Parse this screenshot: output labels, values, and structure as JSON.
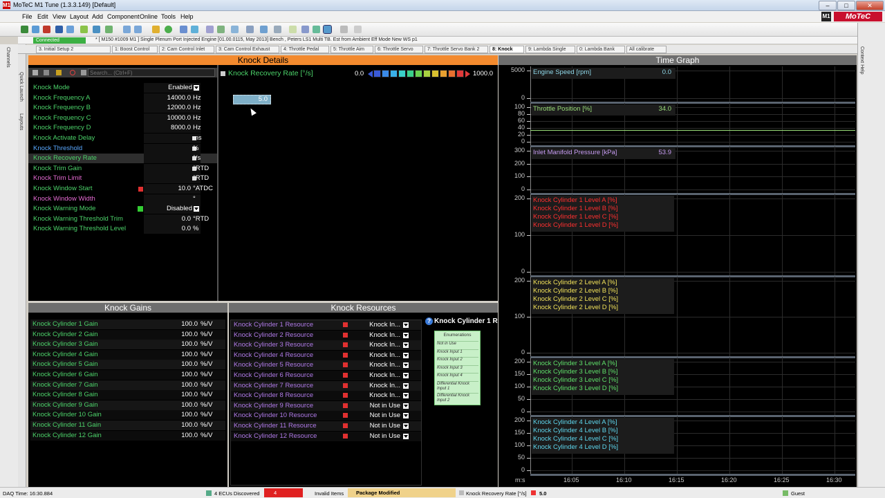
{
  "window": {
    "title": "MoTeC M1 Tune (1.3.3.149) [Default]",
    "min": "–",
    "max": "□",
    "close": "✕",
    "app_icon": "M1"
  },
  "menu": [
    "File",
    "Edit",
    "View",
    "Layout",
    "Add",
    "Component",
    "Online",
    "Tools",
    "Help"
  ],
  "brand": {
    "logo": "MoTeC",
    "m1": "M1"
  },
  "connection": {
    "status": "Connected",
    "desc": "* [ M150 #1009 M1 ]  Single Plenum Port Injected Engine [01.00.0115, May 2013] Bench , Peters LS1 Multi TB. Est from Ambient Eff Mode New WS p1"
  },
  "tabs": [
    "3. Initial Setup 2",
    "1: Boost Control",
    "2: Cam Control Inlet",
    "3: Cam Control Exhaust",
    "4: Throttle Pedal",
    "5: Throttle Aim",
    "6: Throttle Servo",
    "7: Throttle Servo Bank 2",
    "8: Knock",
    "9: Lambda Single",
    "0: Lambda Bank",
    "All calibrate"
  ],
  "side": {
    "channels": "Channels",
    "quick": "Quick Launch",
    "layouts": "Layouts",
    "help": "Context Help"
  },
  "knock_details": {
    "title": "Knock Details",
    "search_placeholder": "Search... (Ctrl+F)",
    "rows": [
      {
        "label": "Knock Mode",
        "value": "Enabled",
        "unit": "",
        "dd": true,
        "color": "#4cd36a"
      },
      {
        "label": "Knock Frequency A",
        "value": "14000.0",
        "unit": "Hz",
        "color": "#4cd36a"
      },
      {
        "label": "Knock Frequency B",
        "value": "12000.0",
        "unit": "Hz",
        "color": "#4cd36a"
      },
      {
        "label": "Knock Frequency C",
        "value": "10000.0",
        "unit": "Hz",
        "color": "#4cd36a"
      },
      {
        "label": "Knock Frequency D",
        "value": "8000.0",
        "unit": "Hz",
        "color": "#4cd36a"
      },
      {
        "label": "Knock Activate Delay",
        "value": "",
        "unit": "ms",
        "sq": true,
        "color": "#4cd36a"
      },
      {
        "label": "Knock Threshold",
        "value": "",
        "unit": "%",
        "sq": true,
        "color": "#5aa8ff"
      },
      {
        "label": "Knock Recovery Rate",
        "value": "",
        "unit": "°/s",
        "sq": true,
        "color": "#4cd36a",
        "selected": true
      },
      {
        "label": "Knock Trim Gain",
        "value": "",
        "unit": "°RTD",
        "sq": true,
        "color": "#4cd36a"
      },
      {
        "label": "Knock Trim Limit",
        "value": "",
        "unit": "°RTD",
        "sq": true,
        "color": "#e46ad2"
      },
      {
        "label": "Knock Window Start",
        "value": "10.0",
        "unit": "°ATDC",
        "flag": true,
        "color": "#4cd36a"
      },
      {
        "label": "Knock Window Width",
        "value": "",
        "unit": "°",
        "color": "#e46ad2"
      },
      {
        "label": "Knock Warning Mode",
        "value": "Disabled",
        "unit": "",
        "dd": true,
        "mark": true,
        "color": "#4cd36a"
      },
      {
        "label": "Knock Warning Threshold Trim",
        "value": "0.0",
        "unit": "°RTD",
        "color": "#4cd36a"
      },
      {
        "label": "Knock Warning Threshold Level",
        "value": "0.0",
        "unit": "%",
        "color": "#4cd36a"
      }
    ]
  },
  "recovery": {
    "title": "Knock Recovery Rate [°/s]",
    "min": "0.0",
    "max": "1000.0",
    "cell": "5.0"
  },
  "gains": {
    "title": "Knock Gains",
    "rows": [
      {
        "label": "Knock Cylinder 1 Gain",
        "value": "100.0",
        "unit": "%/V"
      },
      {
        "label": "Knock Cylinder 2 Gain",
        "value": "100.0",
        "unit": "%/V"
      },
      {
        "label": "Knock Cylinder 3 Gain",
        "value": "100.0",
        "unit": "%/V"
      },
      {
        "label": "Knock Cylinder 4 Gain",
        "value": "100.0",
        "unit": "%/V"
      },
      {
        "label": "Knock Cylinder 5 Gain",
        "value": "100.0",
        "unit": "%/V"
      },
      {
        "label": "Knock Cylinder 6 Gain",
        "value": "100.0",
        "unit": "%/V"
      },
      {
        "label": "Knock Cylinder 7 Gain",
        "value": "100.0",
        "unit": "%/V"
      },
      {
        "label": "Knock Cylinder 8 Gain",
        "value": "100.0",
        "unit": "%/V"
      },
      {
        "label": "Knock Cylinder 9 Gain",
        "value": "100.0",
        "unit": "%/V"
      },
      {
        "label": "Knock Cylinder 10 Gain",
        "value": "100.0",
        "unit": "%/V"
      },
      {
        "label": "Knock Cylinder 11 Gain",
        "value": "100.0",
        "unit": "%/V"
      },
      {
        "label": "Knock Cylinder 12 Gain",
        "value": "100.0",
        "unit": "%/V"
      }
    ]
  },
  "resources": {
    "title": "Knock Resources",
    "rows": [
      {
        "label": "Knock Cylinder 1 Resource",
        "value": "Knock In..."
      },
      {
        "label": "Knock Cylinder 2 Resource",
        "value": "Knock In..."
      },
      {
        "label": "Knock Cylinder 3 Resource",
        "value": "Knock In..."
      },
      {
        "label": "Knock Cylinder 4 Resource",
        "value": "Knock In..."
      },
      {
        "label": "Knock Cylinder 5 Resource",
        "value": "Knock In..."
      },
      {
        "label": "Knock Cylinder 6 Resource",
        "value": "Knock In..."
      },
      {
        "label": "Knock Cylinder 7 Resource",
        "value": "Knock In..."
      },
      {
        "label": "Knock Cylinder 8 Resource",
        "value": "Knock In..."
      },
      {
        "label": "Knock Cylinder 9 Resource",
        "value": "Not in Use"
      },
      {
        "label": "Knock Cylinder 10 Resource",
        "value": "Not in Use"
      },
      {
        "label": "Knock Cylinder 11 Resource",
        "value": "Not in Use"
      },
      {
        "label": "Knock Cylinder 12 Resource",
        "value": "Not in Use"
      }
    ]
  },
  "help": {
    "title": "Knock Cylinder 1 R",
    "enum_title": "Enumerations",
    "items": [
      "Not in Use",
      "Knock Input 1",
      "Knock Input 2",
      "Knock Input 3",
      "Knock Input 4",
      "Differential Knock Input 1",
      "Differential Knock Input 2"
    ]
  },
  "timegraph": {
    "title": "Time Graph",
    "x_unit": "m:s",
    "x_ticks": [
      "16:05",
      "16:10",
      "16:15",
      "16:20",
      "16:25",
      "16:30"
    ],
    "panes": [
      {
        "labels": [
          {
            "t": "Engine Speed [rpm]",
            "v": "0.0",
            "c": "#8fd8e8"
          }
        ],
        "ticks": [
          "5000",
          "0"
        ]
      },
      {
        "labels": [
          {
            "t": "Throttle Position [%]",
            "v": "34.0",
            "c": "#9be07a"
          }
        ],
        "ticks": [
          "100",
          "80",
          "60",
          "40",
          "20",
          "0"
        ]
      },
      {
        "labels": [
          {
            "t": "Inlet Manifold Pressure [kPa]",
            "v": "53.9",
            "c": "#c79cf2"
          }
        ],
        "ticks": [
          "300",
          "200",
          "100",
          "0"
        ]
      },
      {
        "labels": [
          {
            "t": "Knock Cylinder 1 Level A [%]",
            "c": "#ff3030"
          },
          {
            "t": "Knock Cylinder 1 Level B [%]",
            "c": "#ff3030"
          },
          {
            "t": "Knock Cylinder 1 Level C [%]",
            "c": "#ff3030"
          },
          {
            "t": "Knock Cylinder 1 Level D [%]",
            "c": "#ff3030"
          }
        ],
        "ticks": [
          "200",
          "100",
          "0"
        ]
      },
      {
        "labels": [
          {
            "t": "Knock Cylinder 2 Level A [%]",
            "c": "#f2e25a"
          },
          {
            "t": "Knock Cylinder 2 Level B [%]",
            "c": "#f2e25a"
          },
          {
            "t": "Knock Cylinder 2 Level C [%]",
            "c": "#f2e25a"
          },
          {
            "t": "Knock Cylinder 2 Level D [%]",
            "c": "#f2e25a"
          }
        ],
        "ticks": [
          "200",
          "100",
          "0"
        ]
      },
      {
        "labels": [
          {
            "t": "Knock Cylinder 3 Level A [%]",
            "c": "#5fe06a"
          },
          {
            "t": "Knock Cylinder 3 Level B [%]",
            "c": "#5fe06a"
          },
          {
            "t": "Knock Cylinder 3 Level C [%]",
            "c": "#5fe06a"
          },
          {
            "t": "Knock Cylinder 3 Level D [%]",
            "c": "#5fe06a"
          }
        ],
        "ticks": [
          "200",
          "150",
          "100",
          "50",
          "0"
        ]
      },
      {
        "labels": [
          {
            "t": "Knock Cylinder 4 Level A [%]",
            "c": "#5fd8ef"
          },
          {
            "t": "Knock Cylinder 4 Level B [%]",
            "c": "#5fd8ef"
          },
          {
            "t": "Knock Cylinder 4 Level C [%]",
            "c": "#5fd8ef"
          },
          {
            "t": "Knock Cylinder 4 Level D [%]",
            "c": "#5fd8ef"
          }
        ],
        "ticks": [
          "200",
          "150",
          "100",
          "50",
          "0"
        ]
      }
    ]
  },
  "status": {
    "daq": "DAQ Time: 16:30.884",
    "ecus": "4 ECUs Discovered",
    "errors": "4",
    "invalid": "Invalid Items",
    "package": "Package Modified",
    "channel": "Knock Recovery Rate [°/s]",
    "value": "5.0",
    "user": "Guest"
  }
}
